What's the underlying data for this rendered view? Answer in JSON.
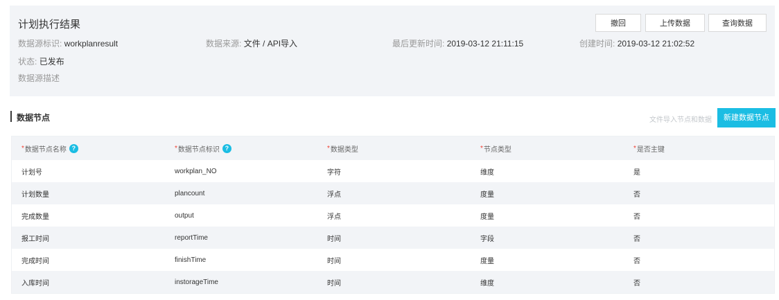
{
  "header": {
    "title": "计划执行结果",
    "buttons": {
      "withdraw": "撤回",
      "upload": "上传数据",
      "query": "查询数据"
    },
    "meta": {
      "id_label": "数据源标识:",
      "id_value": "workplanresult",
      "source_label": "数据来源:",
      "source_value": "文件 / API导入",
      "updated_label": "最后更新时间:",
      "updated_value": "2019-03-12 21:11:15",
      "created_label": "创建时间:",
      "created_value": "2019-03-12 21:02:52",
      "status_label": "状态:",
      "status_value": "已发布",
      "description_label": "数据源描述"
    }
  },
  "section": {
    "title": "数据节点",
    "import_link": "文件导入节点和数据",
    "new_button": "新建数据节点"
  },
  "table": {
    "columns": [
      {
        "label": "数据节点名称",
        "required": "*",
        "help": "?"
      },
      {
        "label": "数据节点标识",
        "required": "*",
        "help": "?"
      },
      {
        "label": "数据类型",
        "required": "*"
      },
      {
        "label": "节点类型",
        "required": "*"
      },
      {
        "label": "是否主键",
        "required": "*"
      }
    ],
    "rows": [
      [
        "计划号",
        "workplan_NO",
        "字符",
        "维度",
        "是"
      ],
      [
        "计划数量",
        "plancount",
        "浮点",
        "度量",
        "否"
      ],
      [
        "完成数量",
        "output",
        "浮点",
        "度量",
        "否"
      ],
      [
        "报工时间",
        "reportTime",
        "时间",
        "字段",
        "否"
      ],
      [
        "完成时间",
        "finishTime",
        "时间",
        "度量",
        "否"
      ],
      [
        "入库时间",
        "instorageTime",
        "时间",
        "维度",
        "否"
      ]
    ]
  },
  "colors": {
    "accent": "#1bbde3",
    "panel_bg": "#f2f4f7",
    "required": "#f04134"
  },
  "icons": {
    "help": "question-circle-icon"
  }
}
